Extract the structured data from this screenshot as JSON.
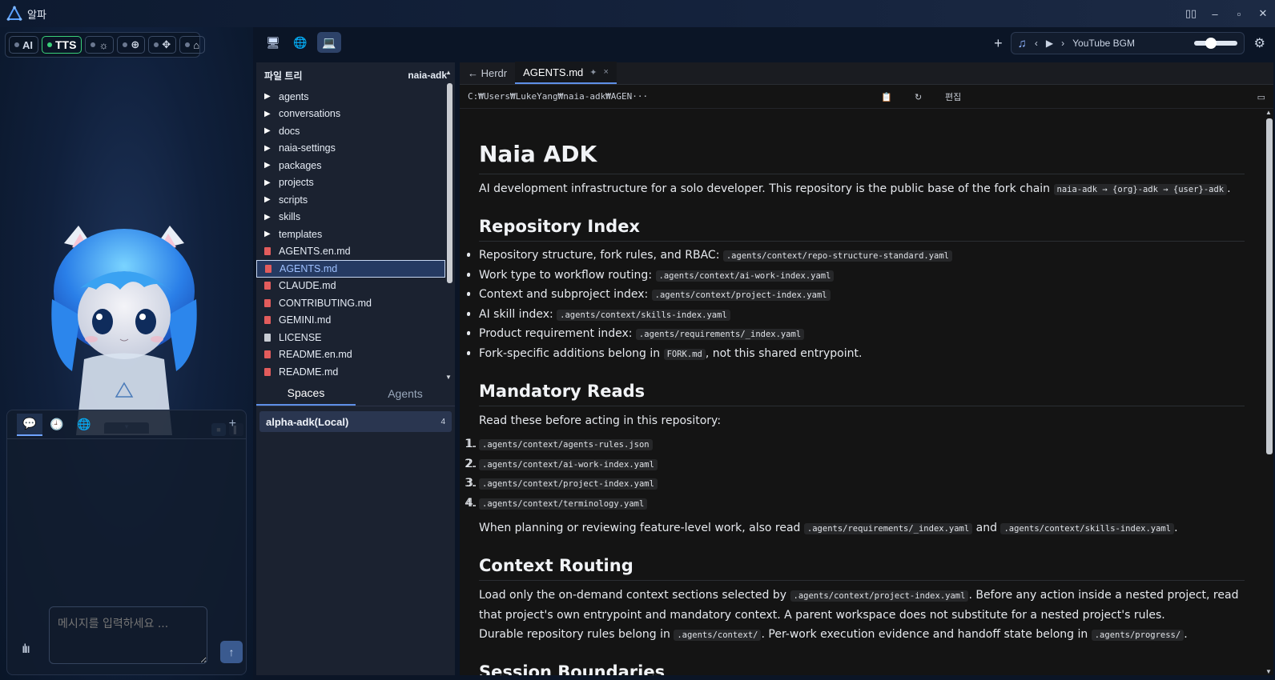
{
  "window": {
    "title": "알파",
    "controls": [
      "sidebar-toggle",
      "minimize",
      "maximize",
      "close"
    ]
  },
  "left": {
    "modes": [
      {
        "label": "AI",
        "active": false
      },
      {
        "label": "TTS",
        "active": true
      },
      {
        "label": "☼",
        "active": false
      },
      {
        "label": "⊕",
        "active": false
      },
      {
        "label": "✥",
        "active": false
      },
      {
        "label": "⌂",
        "active": false
      }
    ],
    "view_toggle": [
      "■",
      "▌"
    ],
    "collapse_caret": "▾",
    "chat": {
      "tabs": [
        "chat-icon",
        "history-icon",
        "globe-icon"
      ],
      "add": "+",
      "input_placeholder": "메시지를 입력하세요 ...",
      "send": "↑"
    }
  },
  "toolbar": {
    "views": [
      "monitor-icon",
      "globe-icon",
      "laptop-icon"
    ],
    "add": "+",
    "bgm": {
      "prev": "‹",
      "play": "▶",
      "next": "›",
      "title": "YouTube BGM",
      "volume": 0.35
    }
  },
  "file_tree": {
    "header": "파일 트리",
    "root": "naia-adk",
    "items": [
      {
        "name": "agents",
        "type": "folder"
      },
      {
        "name": "conversations",
        "type": "folder"
      },
      {
        "name": "docs",
        "type": "folder"
      },
      {
        "name": "naia-settings",
        "type": "folder"
      },
      {
        "name": "packages",
        "type": "folder"
      },
      {
        "name": "projects",
        "type": "folder"
      },
      {
        "name": "scripts",
        "type": "folder"
      },
      {
        "name": "skills",
        "type": "folder"
      },
      {
        "name": "templates",
        "type": "folder"
      },
      {
        "name": "AGENTS.en.md",
        "type": "md"
      },
      {
        "name": "AGENTS.md",
        "type": "md",
        "selected": true
      },
      {
        "name": "CLAUDE.md",
        "type": "md"
      },
      {
        "name": "CONTRIBUTING.md",
        "type": "md"
      },
      {
        "name": "GEMINI.md",
        "type": "md"
      },
      {
        "name": "LICENSE",
        "type": "plain"
      },
      {
        "name": "README.en.md",
        "type": "md"
      },
      {
        "name": "README.md",
        "type": "md"
      }
    ],
    "tabs": {
      "spaces": "Spaces",
      "agents": "Agents"
    },
    "space": {
      "name": "alpha-adk(Local)",
      "count": "4"
    }
  },
  "editor": {
    "back_tab": "← Herdr",
    "active_tab": "AGENTS.md",
    "pin": "✦",
    "close": "×",
    "path": "C:₩Users₩LukeYang₩naia-adk₩AGEN···",
    "copy_icon": "📋",
    "refresh": "↻",
    "edit": "편집",
    "doc": {
      "h1": "Naia ADK",
      "intro_text": "AI development infrastructure for a solo developer. This repository is the public base of the fork chain ",
      "intro_code": "naia-adk → {org}-adk → {user}-adk",
      "intro_end": ".",
      "s1_title": "Repository Index",
      "s1_items": [
        {
          "text": "Repository structure, fork rules, and RBAC: ",
          "code": ".agents/context/repo-structure-standard.yaml",
          "tail": ""
        },
        {
          "text": "Work type to workflow routing: ",
          "code": ".agents/context/ai-work-index.yaml",
          "tail": ""
        },
        {
          "text": "Context and subproject index: ",
          "code": ".agents/context/project-index.yaml",
          "tail": ""
        },
        {
          "text": "AI skill index: ",
          "code": ".agents/context/skills-index.yaml",
          "tail": ""
        },
        {
          "text": "Product requirement index: ",
          "code": ".agents/requirements/_index.yaml",
          "tail": ""
        },
        {
          "text": "Fork-specific additions belong in ",
          "code": "FORK.md",
          "tail": ", not this shared entrypoint."
        }
      ],
      "s2_title": "Mandatory Reads",
      "s2_intro": "Read these before acting in this repository:",
      "s2_items": [
        ".agents/context/agents-rules.json",
        ".agents/context/ai-work-index.yaml",
        ".agents/context/project-index.yaml",
        ".agents/context/terminology.yaml"
      ],
      "s2_after_a": "When planning or reviewing feature-level work, also read ",
      "s2_after_code1": ".agents/requirements/_index.yaml",
      "s2_after_and": " and ",
      "s2_after_code2": ".agents/context/skills-index.yaml",
      "s2_after_end": ".",
      "s3_title": "Context Routing",
      "s3_p1_a": "Load only the on-demand context sections selected by ",
      "s3_p1_code": ".agents/context/project-index.yaml",
      "s3_p1_b": ". Before any action inside a nested project, read that project's own entrypoint and mandatory context. A parent workspace does not substitute for a nested project's rules.",
      "s3_p2_a": "Durable repository rules belong in ",
      "s3_p2_code1": ".agents/context/",
      "s3_p2_b": ". Per-work execution evidence and handoff state belong in ",
      "s3_p2_code2": ".agents/progress/",
      "s3_p2_c": ".",
      "s4_title": "Session Boundaries"
    }
  }
}
